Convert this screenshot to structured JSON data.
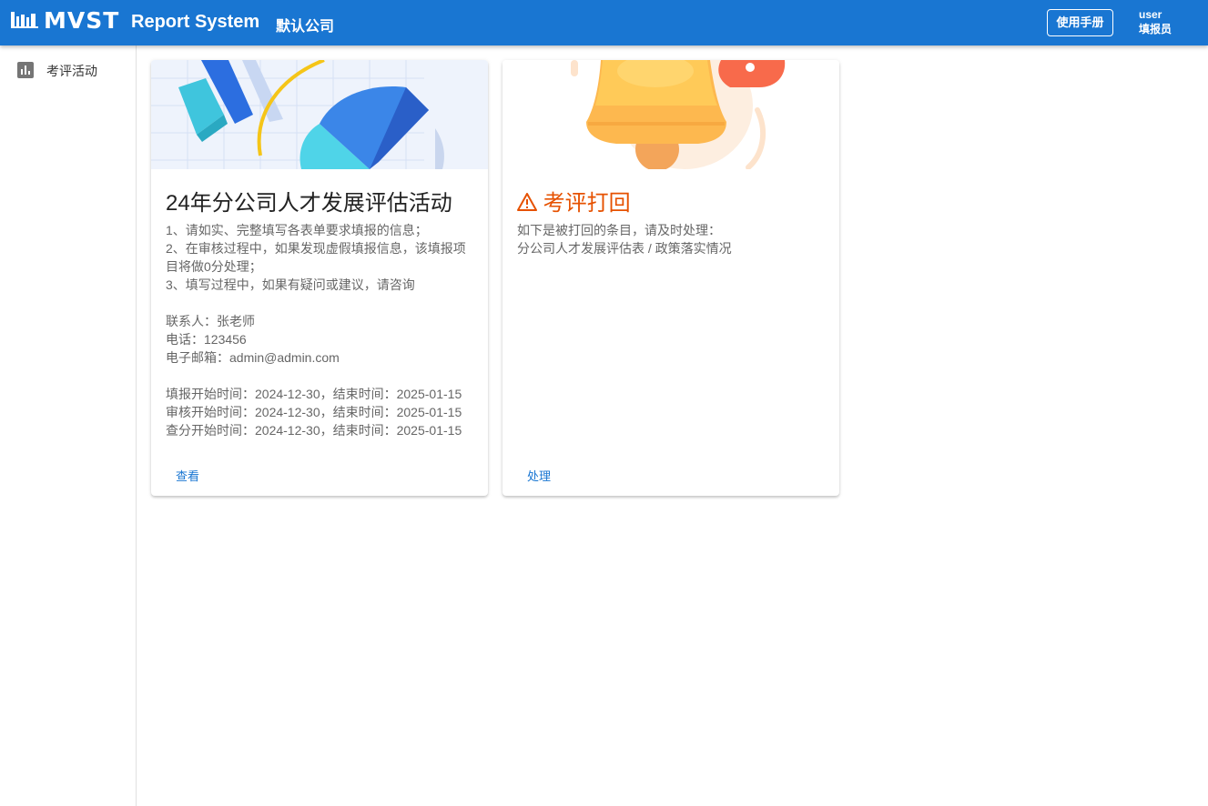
{
  "header": {
    "logo_text": "MVST",
    "app_title": "Report System",
    "company": "默认公司",
    "manual_button": "使用手册",
    "user_name": "user",
    "user_role": "填报员"
  },
  "sidebar": {
    "items": [
      {
        "label": "考评活动",
        "icon": "bar-chart-icon"
      }
    ]
  },
  "cards": [
    {
      "title": "24年分公司人才发展评估活动",
      "lines": [
        "1、请如实、完整填写各表单要求填报的信息；",
        "2、在审核过程中，如果发现虚假填报信息，该填报项目将做0分处理；",
        "3、填写过程中，如果有疑问或建议，请咨询"
      ],
      "contact": [
        "联系人：张老师",
        "电话：123456",
        "电子邮箱：admin@admin.com"
      ],
      "schedule": [
        "填报开始时间：2024-12-30，结束时间：2025-01-15",
        "审核开始时间：2024-12-30，结束时间：2025-01-15",
        "查分开始时间：2024-12-30，结束时间：2025-01-15"
      ],
      "action": "查看"
    },
    {
      "title": "考评打回",
      "icon": "warning-icon",
      "lines": [
        "如下是被打回的条目，请及时处理：",
        "分公司人才发展评估表 / 政策落实情况"
      ],
      "action": "处理"
    }
  ],
  "colors": {
    "primary": "#1976d2",
    "warning": "#e65100"
  }
}
